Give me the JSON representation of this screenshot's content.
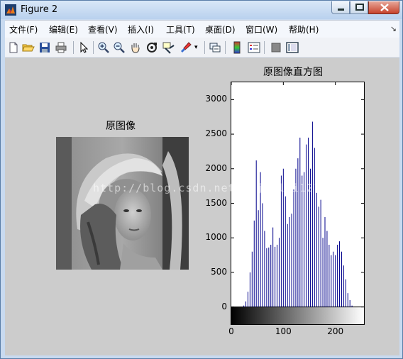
{
  "window": {
    "title": "Figure 2"
  },
  "menu": [
    "文件(F)",
    "编辑(E)",
    "查看(V)",
    "插入(I)",
    "工具(T)",
    "桌面(D)",
    "窗口(W)",
    "帮助(H)"
  ],
  "toolbar": {
    "buttons": [
      "new-figure-icon",
      "open-file-icon",
      "save-icon",
      "print-icon",
      "edit-plot-icon",
      "zoom-in-icon",
      "zoom-out-icon",
      "pan-icon",
      "rotate-3d-icon",
      "data-cursor-icon",
      "brush-icon",
      "link-plot-icon",
      "insert-colorbar-icon",
      "insert-legend-icon",
      "hide-plot-tools-icon",
      "show-plot-tools-icon"
    ]
  },
  "left_axes": {
    "title": "原图像"
  },
  "right_axes": {
    "title": "原图像直方图"
  },
  "watermark": "http://blog.csdn.net/majinlei121",
  "chart_data": {
    "type": "bar",
    "title": "原图像直方图",
    "xlabel": "",
    "ylabel": "",
    "xlim": [
      0,
      255
    ],
    "ylim": [
      -250,
      3250
    ],
    "xticks": [
      "0",
      "100",
      "200"
    ],
    "xtick_values": [
      0,
      100,
      200
    ],
    "yticks": [
      "0",
      "500",
      "1000",
      "1500",
      "2000",
      "2500",
      "3000"
    ],
    "ytick_values": [
      0,
      500,
      1000,
      1500,
      2000,
      2500,
      3000
    ],
    "bar_color": "#00008b",
    "x": [
      24,
      28,
      32,
      36,
      40,
      44,
      48,
      52,
      56,
      60,
      64,
      68,
      72,
      76,
      80,
      84,
      88,
      92,
      96,
      100,
      104,
      108,
      112,
      116,
      120,
      124,
      128,
      132,
      136,
      140,
      144,
      148,
      152,
      156,
      160,
      164,
      168,
      172,
      176,
      180,
      184,
      188,
      192,
      196,
      200,
      204,
      208,
      212,
      216,
      220,
      224,
      228,
      232
    ],
    "values": [
      20,
      80,
      220,
      500,
      800,
      1250,
      2120,
      1400,
      1950,
      1500,
      1100,
      850,
      860,
      900,
      1150,
      870,
      900,
      1000,
      1900,
      2000,
      1600,
      1200,
      1300,
      1350,
      1700,
      2000,
      2150,
      2450,
      1900,
      1950,
      2350,
      2450,
      2000,
      2680,
      2300,
      1650,
      1450,
      1550,
      1000,
      1300,
      1100,
      900,
      750,
      800,
      750,
      900,
      950,
      800,
      600,
      400,
      200,
      100,
      20
    ],
    "colorbar": "grayscale gradient 0-255"
  }
}
